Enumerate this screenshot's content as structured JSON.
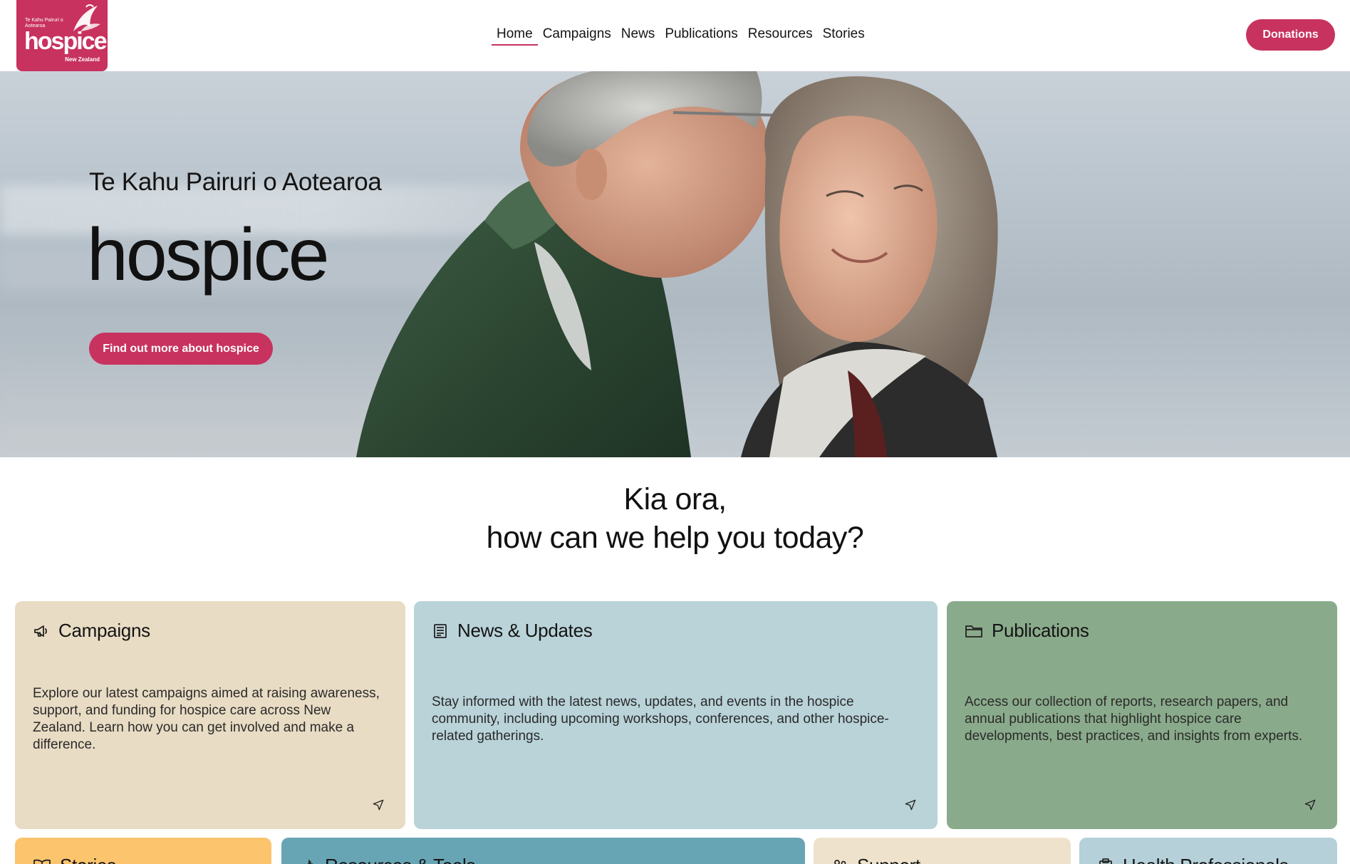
{
  "header": {
    "logo": {
      "small_text": "Te Kahu Pairuri o Aotearoa",
      "word": "hospice",
      "region": "New Zealand"
    },
    "nav": [
      {
        "label": "Home",
        "active": true
      },
      {
        "label": "Campaigns",
        "active": false
      },
      {
        "label": "News",
        "active": false
      },
      {
        "label": "Publications",
        "active": false
      },
      {
        "label": "Resources",
        "active": false
      },
      {
        "label": "Stories",
        "active": false
      }
    ],
    "donate_label": "Donations"
  },
  "hero": {
    "subtitle": "Te Kahu Pairuri o Aotearoa",
    "title": "hospice",
    "button_label": "Find out more about hospice"
  },
  "greeting": {
    "line1": "Kia ora,",
    "line2": "how can we help you today?"
  },
  "cards": [
    {
      "icon": "megaphone-icon",
      "title": "Campaigns",
      "text": "Explore our latest campaigns aimed at raising awareness, support, and funding for hospice care across New Zealand. Learn how you can get involved and make a difference.",
      "color": "#e9dcc4"
    },
    {
      "icon": "newspaper-icon",
      "title": "News & Updates",
      "text": "Stay informed with the latest news, updates, and events in the hospice community, including upcoming workshops, conferences, and other hospice-related gatherings.",
      "color": "#b9d3d9"
    },
    {
      "icon": "folder-icon",
      "title": "Publications",
      "text": "Access our collection of reports, research papers, and annual publications that highlight hospice care developments, best practices, and insights from experts.",
      "color": "#8aab8b"
    },
    {
      "icon": "book-icon",
      "title": "Stories",
      "color": "#fbc46d"
    },
    {
      "icon": "tools-icon",
      "title": "Resources & Tools",
      "color": "#68a5b4"
    },
    {
      "icon": "people-icon",
      "title": "Support",
      "color": "#eee2cc"
    },
    {
      "icon": "clipboard-icon",
      "title": "Health Professionals",
      "color": "#b5d0d8"
    }
  ],
  "colors": {
    "brand": "#c8325f"
  }
}
